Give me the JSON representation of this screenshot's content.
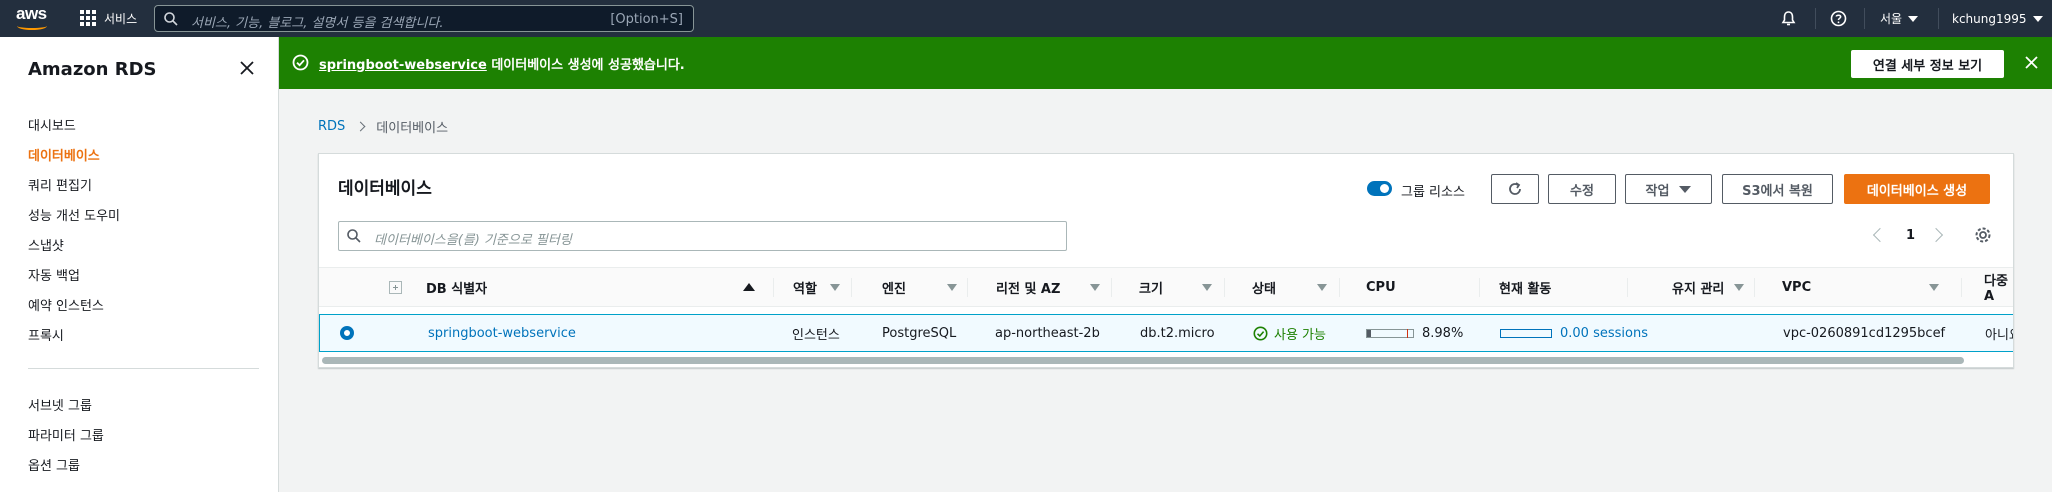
{
  "topnav": {
    "logo_text": "aws",
    "services_label": "서비스",
    "search_placeholder": "서비스, 기능, 블로그, 설명서 등을 검색합니다.",
    "search_shortcut": "[Option+S]",
    "region": "서울",
    "user": "kchung1995"
  },
  "sidebar": {
    "title": "Amazon RDS",
    "items": [
      {
        "label": "대시보드",
        "active": false
      },
      {
        "label": "데이터베이스",
        "active": true
      },
      {
        "label": "쿼리 편집기",
        "active": false
      },
      {
        "label": "성능 개선 도우미",
        "active": false
      },
      {
        "label": "스냅샷",
        "active": false
      },
      {
        "label": "자동 백업",
        "active": false
      },
      {
        "label": "예약 인스턴스",
        "active": false
      },
      {
        "label": "프록시",
        "active": false
      }
    ],
    "items2": [
      {
        "label": "서브넷 그룹"
      },
      {
        "label": "파라미터 그룹"
      },
      {
        "label": "옵션 그룹"
      }
    ]
  },
  "flash": {
    "db_name": "springboot-webservice",
    "message": " 데이터베이스 생성에 성공했습니다.",
    "button": "연결 세부 정보 보기",
    "color": "#1d8102"
  },
  "breadcrumb": {
    "root": "RDS",
    "current": "데이터베이스"
  },
  "panel": {
    "title": "데이터베이스",
    "group_toggle_label": "그룹 리소스",
    "modify_button": "수정",
    "actions_button": "작업",
    "restore_button": "S3에서 복원",
    "create_button": "데이터베이스 생성",
    "filter_placeholder": "데이터베이스을(를) 기준으로 필터링",
    "page": "1"
  },
  "table": {
    "columns": [
      "DB 식별자",
      "역할",
      "엔진",
      "리전 및 AZ",
      "크기",
      "상태",
      "CPU",
      "현재 활동",
      "유지 관리",
      "VPC",
      "다중 A"
    ],
    "row": {
      "identifier": "springboot-webservice",
      "role": "인스턴스",
      "engine": "PostgreSQL",
      "region_az": "ap-northeast-2b",
      "size": "db.t2.micro",
      "status": "사용 가능",
      "cpu": "8.98%",
      "cpu_fraction": 0.0898,
      "activity": "0.00 sessions",
      "maintenance": "",
      "vpc": "vpc-0260891cd1295bcef",
      "multi_az": "아니요"
    }
  },
  "colors": {
    "nav_bg": "#232f3e",
    "accent_orange": "#ec7211",
    "link_blue": "#0073bb",
    "success_green": "#1d8102"
  }
}
